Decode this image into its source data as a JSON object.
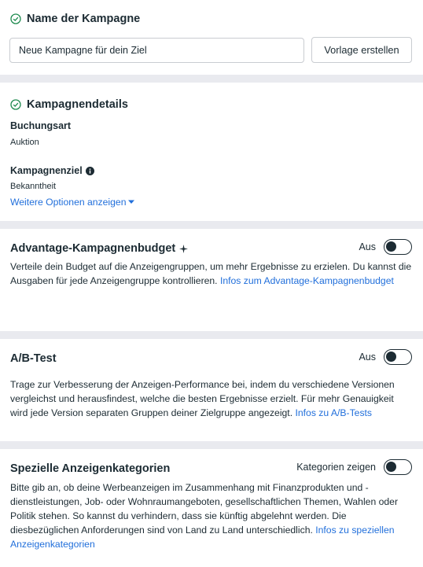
{
  "name_section": {
    "title": "Name der Kampagne",
    "campaign_name_value": "Neue Kampagne für dein Ziel",
    "template_button": "Vorlage erstellen"
  },
  "details_section": {
    "title": "Kampagnendetails",
    "booking_label": "Buchungsart",
    "booking_value": "Auktion",
    "objective_label": "Kampagnenziel",
    "objective_value": "Bekanntheit",
    "more_options": "Weitere Optionen anzeigen"
  },
  "advantage_section": {
    "title": "Advantage-Kampagnenbudget",
    "toggle_label": "Aus",
    "description": "Verteile dein Budget auf die Anzeigengruppen, um mehr Ergebnisse zu erzielen. Du kannst die Ausgaben für jede Anzeigengruppe kontrollieren.",
    "link": "Infos zum Advantage-Kampagnenbudget"
  },
  "ab_section": {
    "title": "A/B-Test",
    "toggle_label": "Aus",
    "description": "Trage zur Verbesserung der Anzeigen-Performance bei, indem du verschiedene Versionen vergleichst und herausfindest, welche die besten Ergebnisse erzielt. Für mehr Genauigkeit wird jede Version separaten Gruppen deiner Zielgruppe angezeigt.",
    "link": "Infos zu A/B-Tests"
  },
  "special_section": {
    "title": "Spezielle Anzeigenkategorien",
    "toggle_label": "Kategorien zeigen",
    "description": "Bitte gib an, ob deine Werbeanzeigen im Zusammenhang mit Finanzprodukten und -dienstleistungen, Job- oder Wohnraumangeboten, gesellschaftlichen Themen, Wahlen oder Politik stehen. So kannst du verhindern, dass sie künftig abgelehnt werden. Die diesbezüglichen Anforderungen sind von Land zu Land unterschiedlich.",
    "link": "Infos zu speziellen Anzeigenkategorien"
  },
  "colors": {
    "accent": "#216fdb",
    "check": "#1d8a4e",
    "text": "#1c2b33"
  }
}
